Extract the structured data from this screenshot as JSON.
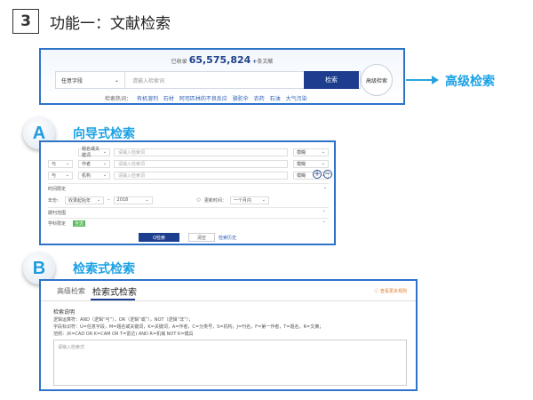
{
  "header": {
    "number": "3",
    "title": "功能一：文献检索"
  },
  "top_search": {
    "count_prefix": "已收录",
    "count": "65,575,824",
    "count_plus": "+",
    "count_suffix": "条文献",
    "field_select": "任意字段",
    "placeholder": "请输入检索词",
    "search_label": "检索",
    "advanced_label": "高级检索",
    "hot_label": "检索热词：",
    "hot_words": [
      "有机溶剂",
      "石材",
      "阿司匹林的不良反应",
      "骆驼伞",
      "农药",
      "石油",
      "大气污染"
    ]
  },
  "callout": {
    "advanced": "高级检索"
  },
  "section_a": {
    "badge": "A",
    "title": "向导式检索"
  },
  "guided": {
    "row1": {
      "field": "题名或关键词",
      "placeholder": "请输入检索词",
      "match": "模糊"
    },
    "row2": {
      "logic": "与",
      "field": "作者",
      "placeholder": "请输入检索词",
      "match": "模糊"
    },
    "row3": {
      "logic": "与",
      "field": "机构",
      "placeholder": "请输入检索词",
      "match": "模糊"
    },
    "plus": "+",
    "minus": "−",
    "time_label": "时间限定",
    "year_label": "年份：",
    "year_from": "收录起始年",
    "year_to": "2018",
    "update_label": "更新时间：",
    "update_val": "一个月内",
    "journal_label": "期刊范围",
    "subject_label": "学科限定",
    "subject_tag": "全选",
    "search_btn": "Q检索",
    "reset_btn": "清空",
    "history": "检索历史"
  },
  "section_b": {
    "badge": "B",
    "title": "检索式检索"
  },
  "expert": {
    "tab_advanced": "高级检索",
    "tab_expert": "检索式检索",
    "help": "ⓘ 查看更多规则",
    "desc_title": "检索说明",
    "desc1": "逻辑运算符：AND（逻辑“与”），OR（逻辑“或”），NOT（逻辑“非”）；",
    "desc2": "字段标识符：U=任意字段，M=题名或关键词，K=关键词，A=作者，C=分类号，S=机构，J=刊名，F=第一作者，T=题名，R=文摘；",
    "desc3": "范例：(K=CAD OR K=CAM OR T=雷达) AND R=机械 NOT K=模具",
    "placeholder": "请输入检索式"
  }
}
